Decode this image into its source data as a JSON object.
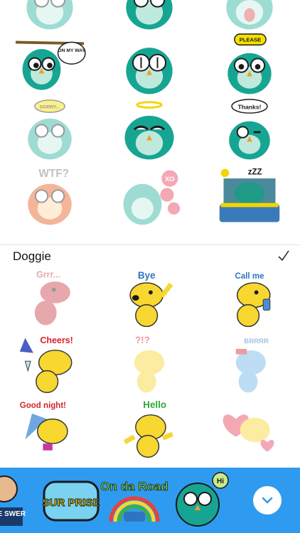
{
  "sections": {
    "doggie": {
      "title": "Doggie",
      "selected": true,
      "check_icon": "checkmark-icon"
    }
  },
  "owl_stickers": [
    {
      "name": "owl-blue-1",
      "text": ""
    },
    {
      "name": "owl-thumbs-up",
      "text": ""
    },
    {
      "name": "owl-shock",
      "text": ""
    },
    {
      "name": "owl-on-my-way",
      "text": "ON MY WAY"
    },
    {
      "name": "owl-staring",
      "text": ""
    },
    {
      "name": "owl-please",
      "text": "PLEASE"
    },
    {
      "name": "owl-sorry",
      "text": "SORRY..."
    },
    {
      "name": "owl-angel",
      "text": ""
    },
    {
      "name": "owl-thanks",
      "text": "Thanks!"
    },
    {
      "name": "owl-wtf",
      "text": "WTF?"
    },
    {
      "name": "owl-xoxo",
      "text": "XO"
    },
    {
      "name": "owl-sleeping",
      "text": "zZZ"
    }
  ],
  "dog_stickers": [
    {
      "name": "dog-grrr",
      "text": "Grrr..."
    },
    {
      "name": "dog-bye",
      "text": "Bye"
    },
    {
      "name": "dog-call-me",
      "text": "Call me"
    },
    {
      "name": "dog-cheers",
      "text": "Cheers!"
    },
    {
      "name": "dog-question",
      "text": "?!?"
    },
    {
      "name": "dog-brrrr",
      "text": "BRRRR"
    },
    {
      "name": "dog-good-night",
      "text": "Good night!"
    },
    {
      "name": "dog-hello",
      "text": "Hello"
    },
    {
      "name": "dog-love",
      "text": ""
    }
  ],
  "bottom_bar": {
    "items": [
      {
        "name": "please-answer",
        "text": "EASE SWER"
      },
      {
        "name": "surprise",
        "text": "SUR PRISE"
      },
      {
        "name": "on-da-road",
        "text": "On da Road"
      },
      {
        "name": "owl-hi",
        "text": "Hi"
      }
    ],
    "collapse_icon": "chevron-down-icon"
  },
  "colors": {
    "owl_teal": "#2bb3a0",
    "dog_yellow": "#f7d730",
    "dog_red": "#c8404a",
    "bar_blue": "#2f9bf0"
  }
}
